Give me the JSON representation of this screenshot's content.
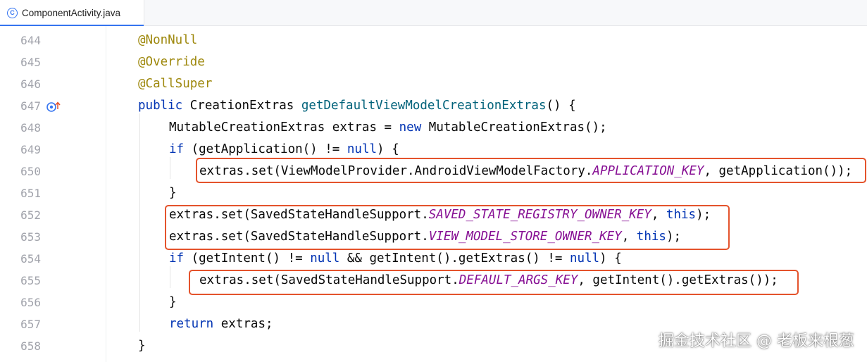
{
  "tab": {
    "filename": "ComponentActivity.java",
    "icon": "java-class-icon"
  },
  "lines": [
    {
      "num": "644",
      "tokens": [
        {
          "t": "@NonNull",
          "c": "ann"
        }
      ]
    },
    {
      "num": "645",
      "tokens": [
        {
          "t": "@Override",
          "c": "ann"
        }
      ]
    },
    {
      "num": "646",
      "tokens": [
        {
          "t": "@CallSuper",
          "c": "ann"
        }
      ]
    },
    {
      "num": "647",
      "tokens": [
        {
          "t": "public ",
          "c": "kw"
        },
        {
          "t": "CreationExtras ",
          "c": ""
        },
        {
          "t": "getDefaultViewModelCreationExtras",
          "c": "fn"
        },
        {
          "t": "() {",
          "c": ""
        }
      ]
    },
    {
      "num": "648",
      "tokens": [
        {
          "t": "MutableCreationExtras extras = ",
          "c": ""
        },
        {
          "t": "new ",
          "c": "kw"
        },
        {
          "t": "MutableCreationExtras();",
          "c": ""
        }
      ]
    },
    {
      "num": "649",
      "tokens": [
        {
          "t": "if ",
          "c": "kw"
        },
        {
          "t": "(getApplication() != ",
          "c": ""
        },
        {
          "t": "null",
          "c": "kw"
        },
        {
          "t": ") {",
          "c": ""
        }
      ]
    },
    {
      "num": "650",
      "tokens": [
        {
          "t": "extras.set(ViewModelProvider.AndroidViewModelFactory.",
          "c": ""
        },
        {
          "t": "APPLICATION_KEY",
          "c": "const"
        },
        {
          "t": ", getApplication());",
          "c": ""
        }
      ]
    },
    {
      "num": "651",
      "tokens": [
        {
          "t": "}",
          "c": ""
        }
      ]
    },
    {
      "num": "652",
      "tokens": [
        {
          "t": "extras.set(SavedStateHandleSupport.",
          "c": ""
        },
        {
          "t": "SAVED_STATE_REGISTRY_OWNER_KEY",
          "c": "const"
        },
        {
          "t": ", ",
          "c": ""
        },
        {
          "t": "this",
          "c": "kw"
        },
        {
          "t": ");",
          "c": ""
        }
      ]
    },
    {
      "num": "653",
      "tokens": [
        {
          "t": "extras.set(SavedStateHandleSupport.",
          "c": ""
        },
        {
          "t": "VIEW_MODEL_STORE_OWNER_KEY",
          "c": "const"
        },
        {
          "t": ", ",
          "c": ""
        },
        {
          "t": "this",
          "c": "kw"
        },
        {
          "t": ");",
          "c": ""
        }
      ]
    },
    {
      "num": "654",
      "tokens": [
        {
          "t": "if ",
          "c": "kw"
        },
        {
          "t": "(getIntent() != ",
          "c": ""
        },
        {
          "t": "null ",
          "c": "kw"
        },
        {
          "t": "&& getIntent().getExtras() != ",
          "c": ""
        },
        {
          "t": "null",
          "c": "kw"
        },
        {
          "t": ") {",
          "c": ""
        }
      ]
    },
    {
      "num": "655",
      "tokens": [
        {
          "t": "extras.set(SavedStateHandleSupport.",
          "c": ""
        },
        {
          "t": "DEFAULT_ARGS_KEY",
          "c": "const"
        },
        {
          "t": ", getIntent().getExtras());",
          "c": ""
        }
      ]
    },
    {
      "num": "656",
      "tokens": [
        {
          "t": "}",
          "c": ""
        }
      ]
    },
    {
      "num": "657",
      "tokens": [
        {
          "t": "return ",
          "c": "kw"
        },
        {
          "t": "extras;",
          "c": ""
        }
      ]
    },
    {
      "num": "658",
      "tokens": [
        {
          "t": "}",
          "c": ""
        }
      ]
    }
  ],
  "gutter_icon": "override-method-icon",
  "watermark": "掘金技术社区 @ 老板来根葱",
  "colors": {
    "highlight": "#e4532c",
    "keyword": "#0033b3",
    "annotation": "#9e880d",
    "method": "#00627a",
    "constant": "#871094"
  }
}
